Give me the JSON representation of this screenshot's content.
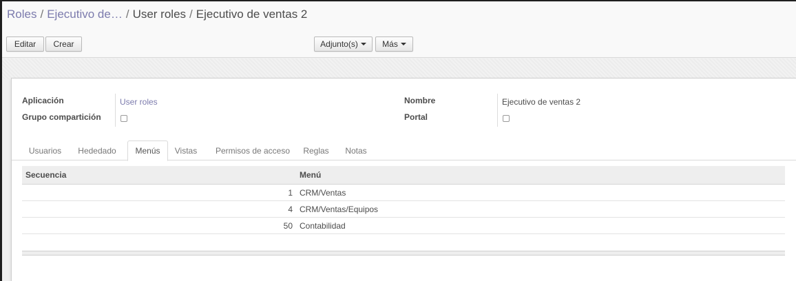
{
  "breadcrumb": {
    "items": [
      {
        "label": "Roles"
      },
      {
        "label": "Ejecutivo de…"
      },
      {
        "label": "User roles"
      },
      {
        "label": "Ejecutivo de ventas 2"
      }
    ],
    "separator": "/"
  },
  "toolbar": {
    "edit_label": "Editar",
    "create_label": "Crear",
    "attachments_label": "Adjunto(s)",
    "more_label": "Más"
  },
  "form": {
    "application_label": "Aplicación",
    "application_value": "User roles",
    "sharing_group_label": "Grupo compartición",
    "sharing_group_checked": false,
    "name_label": "Nombre",
    "name_value": "Ejecutivo de ventas 2",
    "portal_label": "Portal",
    "portal_checked": false
  },
  "tabs": [
    {
      "label": "Usuarios",
      "active": false
    },
    {
      "label": "Hededado",
      "active": false
    },
    {
      "label": "Menús",
      "active": true
    },
    {
      "label": "Vistas",
      "active": false
    },
    {
      "label": "Permisos de acceso",
      "active": false
    },
    {
      "label": "Reglas",
      "active": false
    },
    {
      "label": "Notas",
      "active": false
    }
  ],
  "menus_table": {
    "columns": [
      "Secuencia",
      "Menú"
    ],
    "rows": [
      {
        "sequence": "1",
        "menu": "CRM/Ventas"
      },
      {
        "sequence": "4",
        "menu": "CRM/Ventas/Equipos"
      },
      {
        "sequence": "50",
        "menu": "Contabilidad"
      }
    ]
  },
  "colors": {
    "link": "#7c7bad",
    "text": "#4c4c4c",
    "header_bg": "#eeeeee"
  }
}
